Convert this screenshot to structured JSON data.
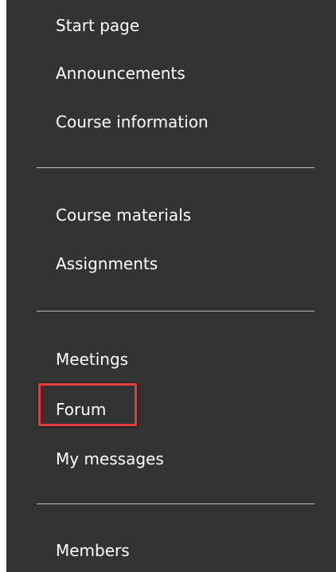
{
  "nav": {
    "group1": {
      "start_page": "Start page",
      "announcements": "Announcements",
      "course_information": "Course information"
    },
    "group2": {
      "course_materials": "Course materials",
      "assignments": "Assignments"
    },
    "group3": {
      "meetings": "Meetings",
      "forum": "Forum",
      "my_messages": "My messages"
    },
    "group4": {
      "members": "Members"
    }
  },
  "highlight": {
    "target": "Forum",
    "color": "#e63b3b"
  },
  "colors": {
    "sidebar_bg": "#333333",
    "text": "#ffffff",
    "divider": "#bdbdbd"
  }
}
